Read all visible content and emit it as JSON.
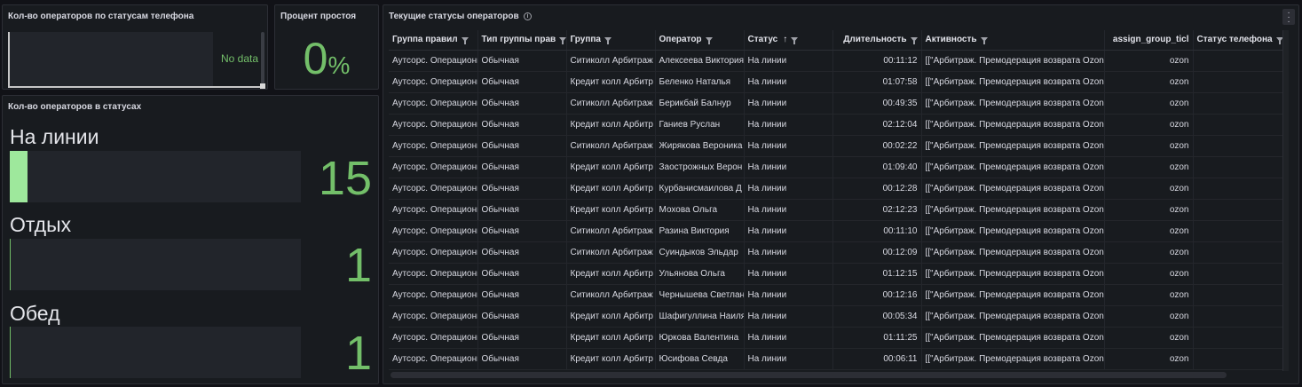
{
  "panels": {
    "phone_status": {
      "title": "Кол-во операторов по статусам телефона",
      "no_data": "No data"
    },
    "idle": {
      "title": "Процент простоя",
      "value": "0",
      "unit": "%"
    },
    "statuses": {
      "title": "Кол-во операторов в статусах",
      "bars": [
        {
          "label": "На линии",
          "value": "15",
          "fill_fraction": 0.06
        },
        {
          "label": "Отдых",
          "value": "1",
          "fill_fraction": 0.004
        },
        {
          "label": "Обед",
          "value": "1",
          "fill_fraction": 0.004
        }
      ]
    },
    "table": {
      "title": "Текущие статусы операторов",
      "info_icon": "info-icon",
      "columns": [
        "Группа правил",
        "Тип группы прав",
        "Группа",
        "Оператор",
        "Статус",
        "Длительность",
        "Активность",
        "assign_group_ticl",
        "Статус телефона"
      ],
      "rows": [
        [
          "Аутсорс. Операционн",
          "Обычная",
          "Ситиколл Арбитраж",
          "Алексеева Виктория",
          "На линии",
          "00:11:12",
          "[[\"Арбитраж. Премодерация возврата Ozon",
          "ozon",
          ""
        ],
        [
          "Аутсорс. Операционн",
          "Обычная",
          "Кредит колл Арбитр",
          "Беленко Наталья",
          "На линии",
          "01:07:58",
          "[[\"Арбитраж. Премодерация возврата Ozon",
          "ozon",
          ""
        ],
        [
          "Аутсорс. Операционн",
          "Обычная",
          "Ситиколл Арбитраж",
          "Берикбай Балнур",
          "На линии",
          "00:49:35",
          "[[\"Арбитраж. Премодерация возврата Ozon",
          "ozon",
          ""
        ],
        [
          "Аутсорс. Операционн",
          "Обычная",
          "Кредит колл Арбитр",
          "Ганиев Руслан",
          "На линии",
          "02:12:04",
          "[[\"Арбитраж. Премодерация возврата Ozon",
          "ozon",
          ""
        ],
        [
          "Аутсорс. Операционн",
          "Обычная",
          "Ситиколл Арбитраж",
          "Жирякова Вероника",
          "На линии",
          "00:02:22",
          "[[\"Арбитраж. Премодерация возврата Ozon",
          "ozon",
          ""
        ],
        [
          "Аутсорс. Операционн",
          "Обычная",
          "Кредит колл Арбитр",
          "Заострожных Верон",
          "На линии",
          "01:09:40",
          "[[\"Арбитраж. Премодерация возврата Ozon",
          "ozon",
          ""
        ],
        [
          "Аутсорс. Операционн",
          "Обычная",
          "Кредит колл Арбитр",
          "Курбанисмаилова Д",
          "На линии",
          "00:12:28",
          "[[\"Арбитраж. Премодерация возврата Ozon",
          "ozon",
          ""
        ],
        [
          "Аутсорс. Операционн",
          "Обычная",
          "Кредит колл Арбитр",
          "Мохова Ольга",
          "На линии",
          "02:12:23",
          "[[\"Арбитраж. Премодерация возврата Ozon",
          "ozon",
          ""
        ],
        [
          "Аутсорс. Операционн",
          "Обычная",
          "Ситиколл Арбитраж",
          "Разина Виктория",
          "На линии",
          "00:11:10",
          "[[\"Арбитраж. Премодерация возврата Ozon",
          "ozon",
          ""
        ],
        [
          "Аутсорс. Операционн",
          "Обычная",
          "Ситиколл Арбитраж",
          "Суиндыков Эльдар",
          "На линии",
          "00:12:09",
          "[[\"Арбитраж. Премодерация возврата Ozon",
          "ozon",
          ""
        ],
        [
          "Аутсорс. Операционн",
          "Обычная",
          "Кредит колл Арбитр",
          "Ульянова Ольга",
          "На линии",
          "01:12:15",
          "[[\"Арбитраж. Премодерация возврата Ozon",
          "ozon",
          ""
        ],
        [
          "Аутсорс. Операционн",
          "Обычная",
          "Ситиколл Арбитраж",
          "Чернышева Светлан",
          "На линии",
          "00:12:16",
          "[[\"Арбитраж. Премодерация возврата Ozon",
          "ozon",
          ""
        ],
        [
          "Аутсорс. Операционн",
          "Обычная",
          "Кредит колл Арбитр",
          "Шафигуллина Наиля",
          "На линии",
          "00:05:34",
          "[[\"Арбитраж. Премодерация возврата Ozon",
          "ozon",
          ""
        ],
        [
          "Аутсорс. Операционн",
          "Обычная",
          "Кредит колл Арбитр",
          "Юркова Валентина",
          "На линии",
          "01:11:25",
          "[[\"Арбитраж. Премодерация возврата Ozon",
          "ozon",
          ""
        ],
        [
          "Аутсорс. Операционн",
          "Обычная",
          "Кредит колл Арбитр",
          "Юсифова Севда",
          "На линии",
          "00:06:11",
          "[[\"Арбитраж. Премодерация возврата Ozon",
          "ozon",
          ""
        ]
      ]
    }
  },
  "colors": {
    "accent_green": "#73bf69",
    "bar_light_green": "#9ee89c",
    "background": "#111217",
    "panel": "#181b1f"
  }
}
